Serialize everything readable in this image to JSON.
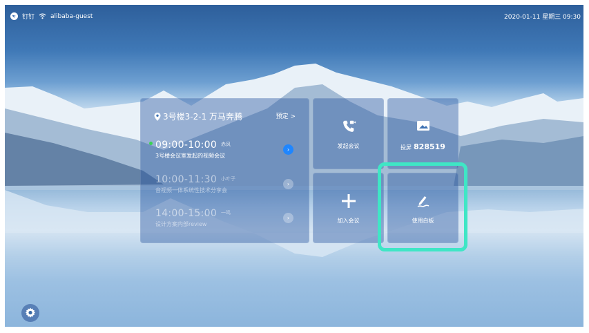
{
  "status_bar": {
    "app_name": "钉钉",
    "wifi_name": "alibaba-guest",
    "datetime": "2020-01-11 星期三 09:30"
  },
  "schedule": {
    "room": "3号楼3-2-1 万马奔腾",
    "book_label": "预定 >",
    "meetings": [
      {
        "time": "09:00-10:00",
        "organizer": "赤风",
        "title": "3号楼会议室发起的视频会议",
        "active": true
      },
      {
        "time": "10:00-11:30",
        "organizer": "小叶子",
        "title": "音视频一体系统性技术分享会",
        "active": false
      },
      {
        "time": "14:00-15:00",
        "organizer": "一鸣",
        "title": "设计方案内部review",
        "active": false
      }
    ]
  },
  "tiles": {
    "start_meeting": "发起会议",
    "cast_label": "投屏",
    "cast_code": "828519",
    "join_meeting": "加入会议",
    "whiteboard": "使用白板"
  },
  "icons": {
    "settings": "gear-icon",
    "location": "location-pin-icon",
    "start_meeting": "phone-video-icon",
    "cast": "screen-cast-icon",
    "join": "plus-icon",
    "whiteboard": "pen-icon"
  },
  "colors": {
    "highlight": "#3fe6c5",
    "active_dot": "#39d353",
    "active_arrow": "#1f86ff"
  }
}
